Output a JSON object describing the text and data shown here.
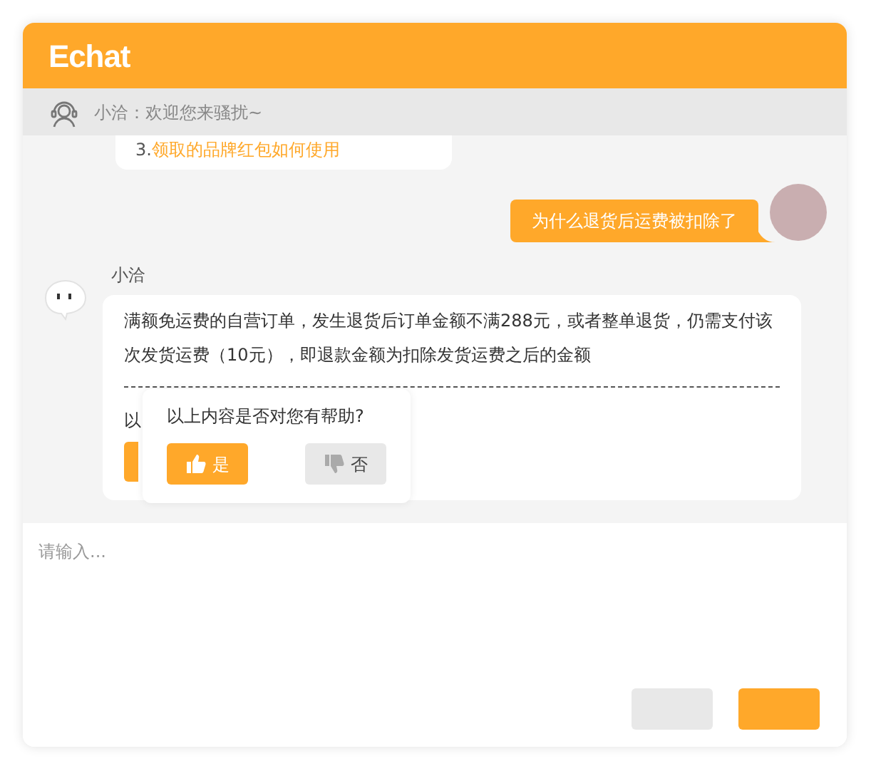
{
  "header": {
    "logo": "Echat"
  },
  "notice": {
    "text": "小洽：欢迎您来骚扰~"
  },
  "messages": [
    {
      "kind": "link_tail",
      "prefix": "3.",
      "link": "领取的品牌红包如何使用"
    },
    {
      "kind": "user",
      "text": "为什么退货后运费被扣除了"
    },
    {
      "kind": "bot",
      "sender": "小洽",
      "text": "满额免运费的自营订单，发生退货后订单金额不满288元，或者整单退货，仍需支付该次发货运费（10元），即退款金额为扣除发货运费之后的金额",
      "tail_text": "以"
    }
  ],
  "feedback": {
    "question": "以上内容是否对您有帮助?",
    "options": [
      {
        "label": "是",
        "selected": true
      },
      {
        "label": "否",
        "selected": false
      }
    ]
  },
  "input": {
    "placeholder": "请输入..."
  }
}
